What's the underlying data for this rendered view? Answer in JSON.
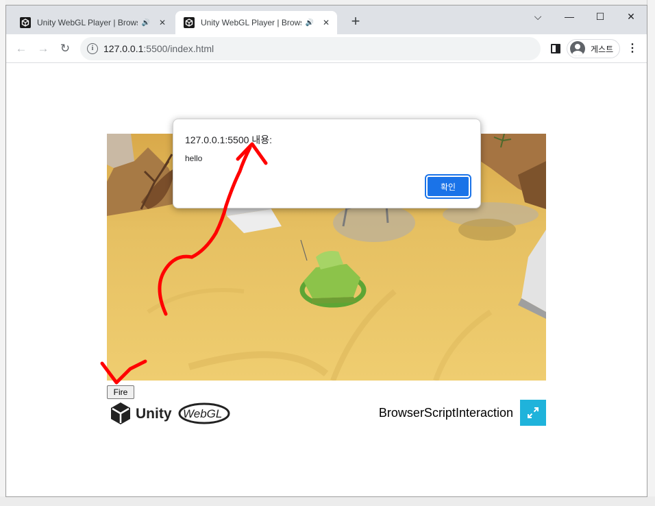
{
  "browser": {
    "tabs": [
      {
        "title": "Unity WebGL Player | Browser",
        "active": false
      },
      {
        "title": "Unity WebGL Player | Browser",
        "active": true
      }
    ],
    "new_tab_label": "+",
    "url_host": "127.0.0.1",
    "url_rest": ":5500/index.html",
    "profile_label": "게스트"
  },
  "dialog": {
    "title": "127.0.0.1:5500 내용:",
    "message": "hello",
    "ok_label": "확인"
  },
  "page": {
    "fire_label": "Fire",
    "footer_title": "BrowserScriptInteraction",
    "logo_text_unity": "Unity",
    "logo_text_webgl": "WebGL"
  },
  "colors": {
    "dialog_ok": "#1a73e8",
    "fullscreen_button": "#1fb3db",
    "annotation": "#ff0000",
    "sand": "#e2bd5c",
    "tank": "#8cc34a"
  }
}
